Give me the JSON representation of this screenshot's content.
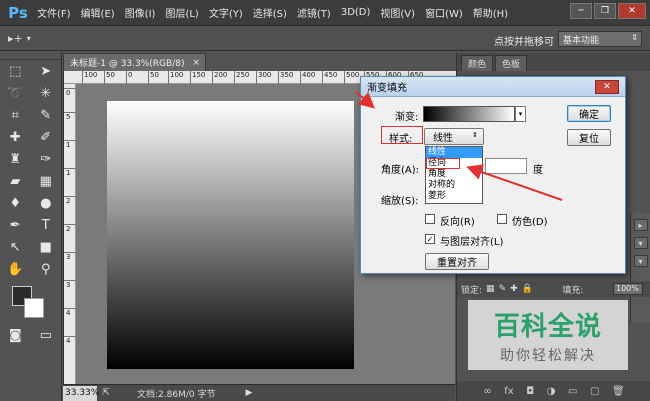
{
  "app": {
    "logo": "Ps"
  },
  "menu": [
    "文件(F)",
    "编辑(E)",
    "图像(I)",
    "图层(L)",
    "文字(Y)",
    "选择(S)",
    "滤镜(T)",
    "3D(D)",
    "视图(V)",
    "窗口(W)",
    "帮助(H)"
  ],
  "window_buttons": {
    "minimize": "─",
    "restore": "❐",
    "close": "✕"
  },
  "options_bar": {
    "move_label": "点按并拖移可",
    "workspace": "基本功能"
  },
  "document": {
    "tab_title": "未标题-1 @ 33.3%(RGB/8)",
    "tab_close": "×"
  },
  "ruler_h": [
    "100",
    "50",
    "0",
    "50",
    "100",
    "150",
    "200",
    "250",
    "300",
    "350",
    "400",
    "450",
    "500",
    "550",
    "600",
    "650"
  ],
  "ruler_v": [
    "0",
    "5",
    "1",
    "1",
    "2",
    "2",
    "3",
    "3",
    "4",
    "4"
  ],
  "status": {
    "zoom": "33.33%",
    "doc_info": "文档:2.86M/0 字节",
    "arrow": "▶"
  },
  "panels": {
    "tab1": "颜色",
    "tab2": "色板",
    "lock_label": "锁定:",
    "fill_label": "填充:",
    "fill_value": "100%"
  },
  "dialog": {
    "title": "渐变填充",
    "close": "✕",
    "gradient_label": "渐变:",
    "ok": "确定",
    "style_label": "样式:",
    "style_value": "线性",
    "reset": "复位",
    "angle_label": "角度(A):",
    "angle_unit": "度",
    "scale_label": "缩放(S):",
    "reverse": "反向(R)",
    "dither": "仿色(D)",
    "align_layer": "与图层对齐(L)",
    "reset_align": "重置对齐",
    "style_options": [
      "线性",
      "径向",
      "角度",
      "对称的",
      "菱形"
    ]
  },
  "watermark": {
    "title": "百科全说",
    "subtitle": "助你轻松解决"
  },
  "colors": {
    "annotation": "#e03030",
    "accent": "#3399ff"
  }
}
